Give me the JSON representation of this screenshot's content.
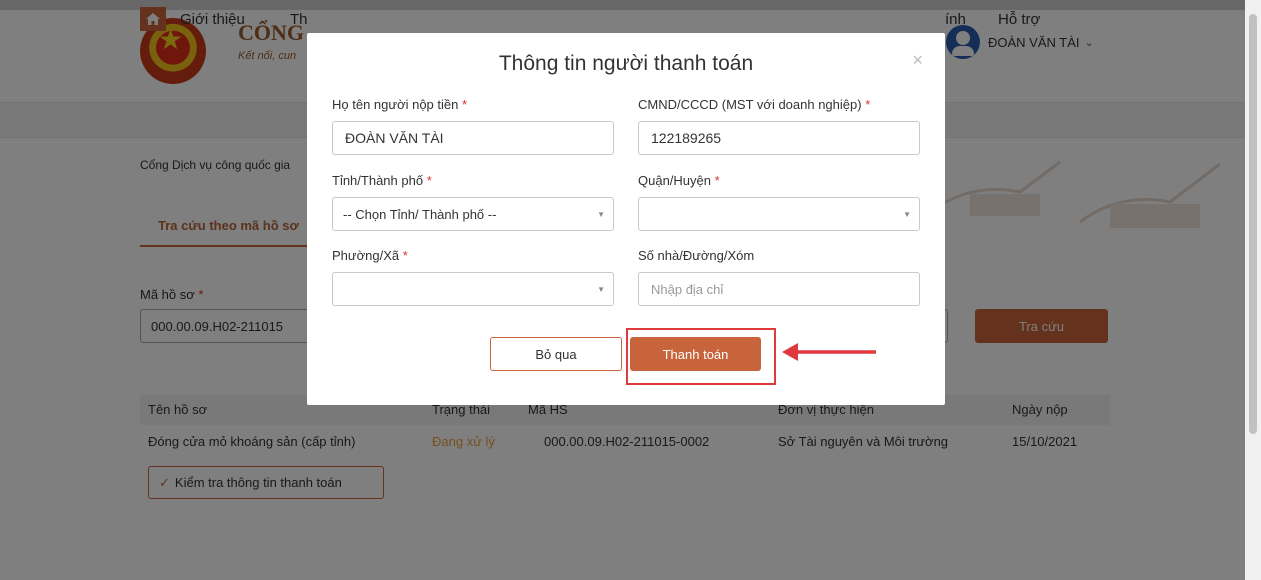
{
  "header": {
    "logo_text": "CỔNG",
    "logo_sub": "Kết nối, cun",
    "user_name": "ĐOÀN VĂN TÀI",
    "user_chevron": "⌄"
  },
  "nav": {
    "home_icon": "home-icon",
    "items": [
      "Giới thiệu",
      "Th",
      "ính",
      "Hỗ trợ"
    ]
  },
  "breadcrumb": "Cổng Dịch vụ công quốc gia",
  "lookup": {
    "tab_label": "Tra cứu theo mã hồ sơ",
    "code_label": "Mã hồ sơ",
    "code_value": "000.00.09.H02-211015",
    "search_button": "Tra cứu"
  },
  "table": {
    "headers": [
      "Tên hồ sơ",
      "Trạng thái",
      "Mã HS",
      "Đơn vị thực hiện",
      "Ngày nộp"
    ],
    "rows": [
      {
        "name": "Đóng cửa mỏ khoáng sản (cấp tỉnh)",
        "status": "Đang xử lý",
        "code": "000.00.09.H02-211015-0002",
        "unit": "Sở Tài nguyên và Môi trường",
        "date": "15/10/2021"
      }
    ],
    "check_button": "Kiểm tra thông tin thanh toán"
  },
  "modal": {
    "title": "Thông tin người thanh toán",
    "close_icon": "×",
    "fields": {
      "payer_name": {
        "label": "Họ tên người nộp tiền",
        "value": "ĐOÀN VĂN TÀI"
      },
      "id_number": {
        "label": "CMND/CCCD (MST với doanh nghiệp)",
        "value": "122189265"
      },
      "province": {
        "label": "Tỉnh/Thành phố",
        "value": "-- Chọn Tỉnh/ Thành phố --"
      },
      "district": {
        "label": "Quận/Huyện",
        "value": ""
      },
      "ward": {
        "label": "Phường/Xã",
        "value": ""
      },
      "address": {
        "label": "Số nhà/Đường/Xóm",
        "placeholder": "Nhập địa chỉ"
      }
    },
    "required_mark": "*",
    "skip_button": "Bỏ qua",
    "pay_button": "Thanh toán"
  },
  "colors": {
    "accent": "#c8643b",
    "highlight": "#e0393e",
    "status": "#e6a03c"
  }
}
